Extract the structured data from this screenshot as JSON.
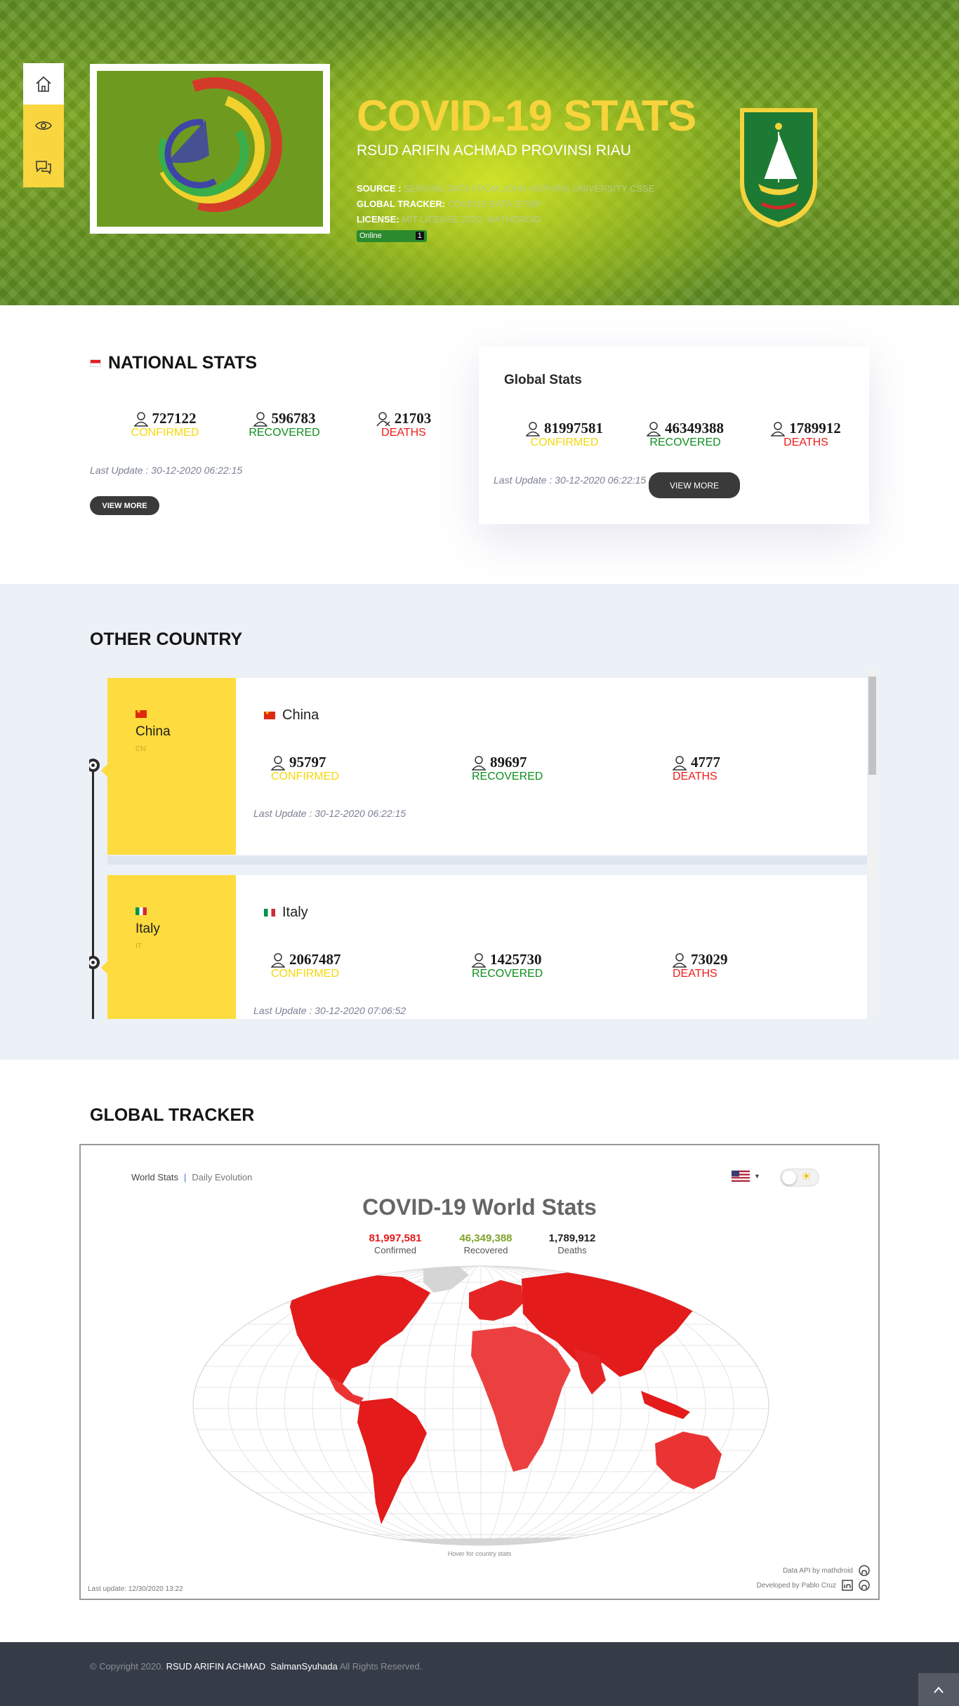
{
  "hero": {
    "title": "COVID-19 STATS",
    "subtitle": "RSUD ARIFIN ACHMAD PROVINSI RIAU",
    "source_label": "SOURCE :",
    "source_value": "SERVING DATA FROM JOHN HOPKINS UNIVERSITY CSSE",
    "tracker_label": "GLOBAL TRACKER:",
    "tracker_value": "COVID19.DATA.ETIBP",
    "license_label": "LICENSE:",
    "license_value": "MIT LICENSE 2020, MATHDROID",
    "online_label": "Online",
    "online_count": "1"
  },
  "nav": {
    "items": [
      {
        "name": "home",
        "icon": "home-icon"
      },
      {
        "name": "view",
        "icon": "eye-icon"
      },
      {
        "name": "chat",
        "icon": "chat-icon"
      }
    ]
  },
  "national": {
    "title": "NATIONAL STATS",
    "confirmed": "727122",
    "recovered": "596783",
    "deaths": "21703",
    "confirmed_label": "CONFIRMED",
    "recovered_label": "RECOVERED",
    "deaths_label": "DEATHS",
    "last_update": "Last Update : 30-12-2020 06:22:15",
    "button": "VIEW MORE"
  },
  "global": {
    "title": "Global Stats",
    "confirmed": "81997581",
    "recovered": "46349388",
    "deaths": "1789912",
    "confirmed_label": "CONFIRMED",
    "recovered_label": "RECOVERED",
    "deaths_label": "DEATHS",
    "last_update": "Last Update : 30-12-2020 06:22:15",
    "button": "VIEW MORE"
  },
  "other": {
    "title": "OTHER COUNTRY",
    "countries": [
      {
        "name": "China",
        "code": "CN",
        "confirmed": "95797",
        "recovered": "89697",
        "deaths": "4777",
        "last_update": "Last Update : 30-12-2020 06:22:15"
      },
      {
        "name": "Italy",
        "code": "IT",
        "confirmed": "2067487",
        "recovered": "1425730",
        "deaths": "73029",
        "last_update": "Last Update : 30-12-2020 07:06:52"
      }
    ],
    "confirmed_label": "CONFIRMED",
    "recovered_label": "RECOVERED",
    "deaths_label": "DEATHS"
  },
  "tracker": {
    "title": "GLOBAL TRACKER",
    "tab_world": "World Stats",
    "tab_sep": "|",
    "tab_daily": "Daily Evolution",
    "map_title": "COVID-19 World Stats",
    "confirmed": "81,997,581",
    "confirmed_label": "Confirmed",
    "recovered": "46,349,388",
    "recovered_label": "Recovered",
    "deaths": "1,789,912",
    "deaths_label": "Deaths",
    "hover_hint": "Hover for country stats",
    "last_update": "Last update: 12/30/2020 13:22",
    "api_credit": "Data API by mathdroid",
    "dev_credit": "Developed by Pablo Cruz",
    "colors": {
      "confirmed": "#e01a1a",
      "recovered": "#7fa32a",
      "map_red": "#e31b1b"
    }
  },
  "footer": {
    "copy_prefix": "© Copyright 2020.",
    "org": "RSUD ARIFIN ACHMAD",
    "author": "SalmanSyuhada",
    "suffix": "All Rights Reserved."
  }
}
